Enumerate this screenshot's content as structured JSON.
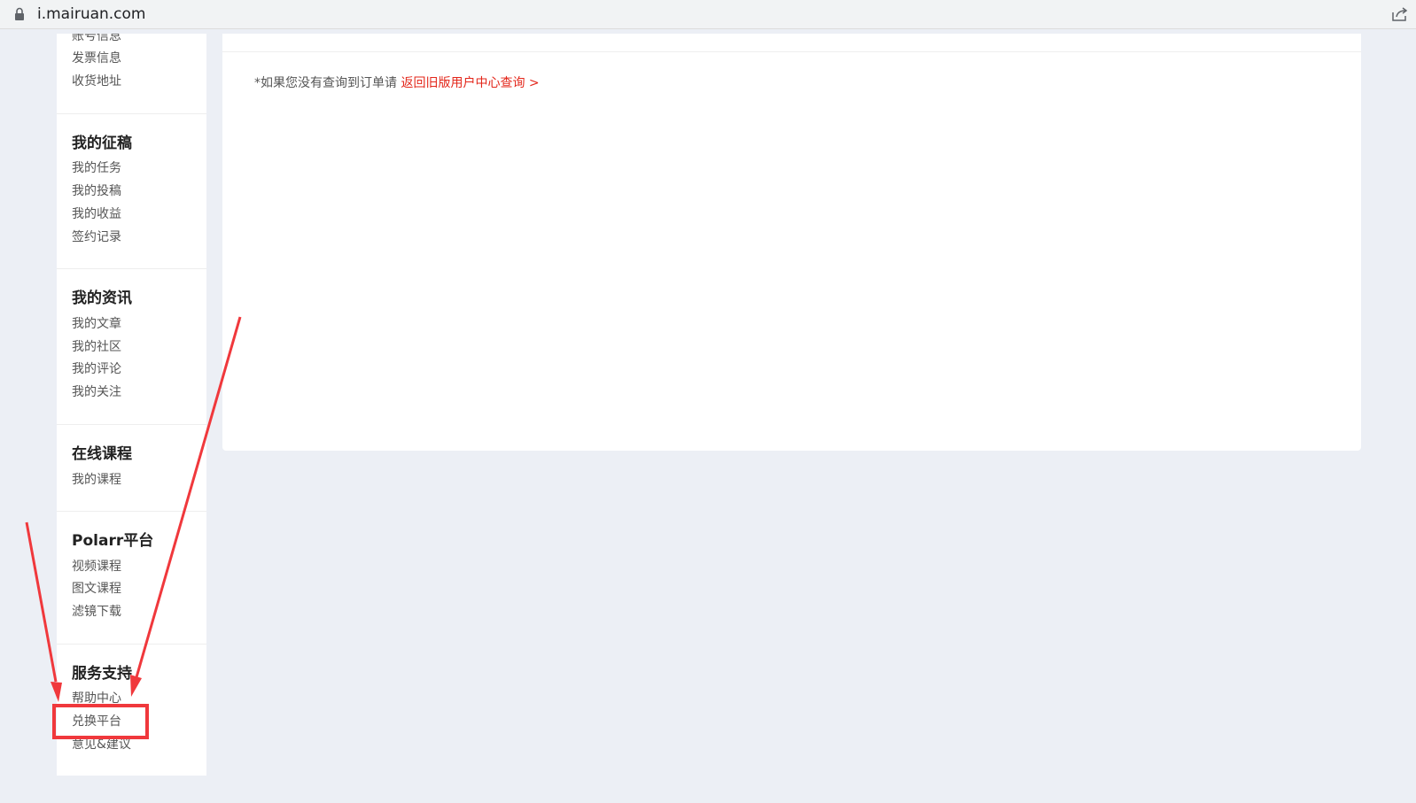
{
  "browser": {
    "url": "i.mairuan.com"
  },
  "sidebar": {
    "partial_item": "账号信息",
    "account_items": [
      "发票信息",
      "收货地址"
    ],
    "sections": [
      {
        "title": "我的征稿",
        "items": [
          "我的任务",
          "我的投稿",
          "我的收益",
          "签约记录"
        ]
      },
      {
        "title": "我的资讯",
        "items": [
          "我的文章",
          "我的社区",
          "我的评论",
          "我的关注"
        ]
      },
      {
        "title": "在线课程",
        "items": [
          "我的课程"
        ]
      },
      {
        "title": "Polarr平台",
        "items": [
          "视频课程",
          "图文课程",
          "滤镜下载"
        ]
      },
      {
        "title": "服务支持",
        "items": [
          "帮助中心",
          "兑换平台",
          "意见&建议"
        ]
      }
    ]
  },
  "main": {
    "notice_text": "*如果您没有查询到订单请 ",
    "notice_link": "返回旧版用户中心查询 >"
  },
  "annotation": {
    "color": "#f0383c",
    "highlighted_item": "兑换平台"
  }
}
